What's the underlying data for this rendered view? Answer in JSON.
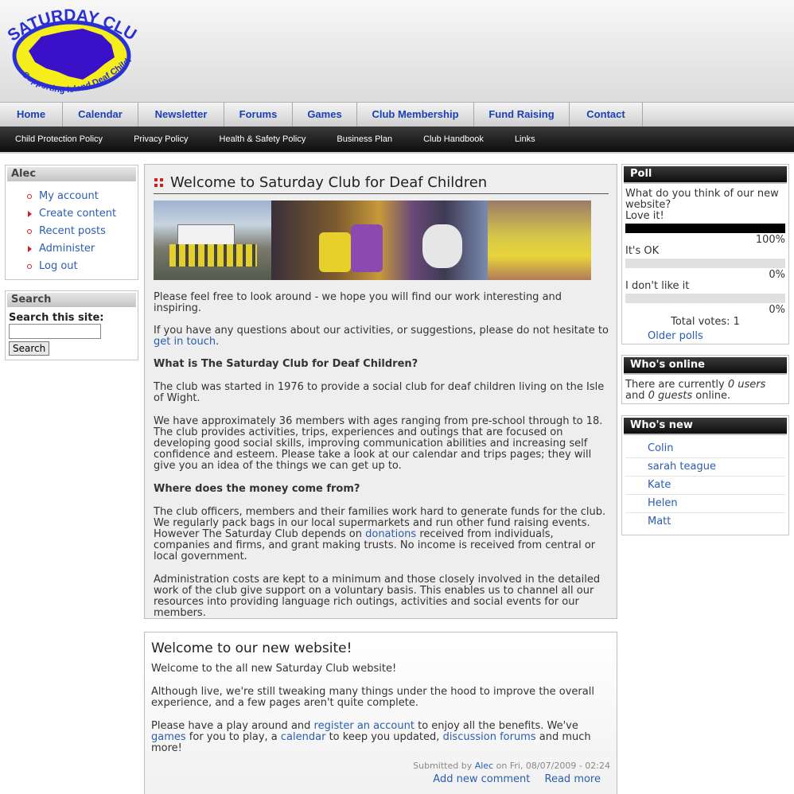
{
  "header": {
    "logo_title": "SATURDAY CLUB",
    "logo_tagline": "Supporting Island Deaf Children"
  },
  "primary_nav": [
    {
      "label": "Home"
    },
    {
      "label": "Calendar"
    },
    {
      "label": "Newsletter"
    },
    {
      "label": "Forums"
    },
    {
      "label": "Games"
    },
    {
      "label": "Club Membership"
    },
    {
      "label": "Fund Raising"
    },
    {
      "label": "Contact"
    }
  ],
  "secondary_nav": [
    {
      "label": "Child Protection Policy"
    },
    {
      "label": "Privacy Policy"
    },
    {
      "label": "Health & Safety Policy"
    },
    {
      "label": "Business Plan"
    },
    {
      "label": "Club Handbook"
    },
    {
      "label": "Links"
    }
  ],
  "user_block": {
    "title": "Alec",
    "items": [
      {
        "label": "My account"
      },
      {
        "label": "Create content"
      },
      {
        "label": "Recent posts"
      },
      {
        "label": "Administer"
      },
      {
        "label": "Log out"
      }
    ]
  },
  "search_block": {
    "title": "Search",
    "label": "Search this site:",
    "input_value": "",
    "button_label": "Search"
  },
  "main_node": {
    "title": "Welcome to Saturday Club for Deaf Children",
    "p1": "Please feel free to look around - we hope you will find our work interesting and inspiring.",
    "p2_text": "If you have any questions about our activities, or suggestions, please do not hesitate to",
    "p2_link": "get in touch",
    "p2_end": ".",
    "h1": "What is The Saturday Club for Deaf Children?",
    "p3": "The club was started in 1976 to provide a social club for deaf children living on the Isle of Wight.",
    "p4": "We have approximately 36 members with ages ranging from pre-school through to 18. The club provides activities, trips, experiences and outings that are focused on developing good social skills, improving communication abilities and increasing self confidence and esteem. Please take a look at our calendar and trips pages; they will give you an idea of the things we can get up to.",
    "h2": "Where does the money come from?",
    "p5_a": "The club officers, members and their families work hard to generate funds for the club. We regularly pack bags in our local supermarkets and run other fund raising events. However The Saturday Club depends on",
    "p5_link": "donations",
    "p5_b": "received from individuals, companies and firms, and grant making trusts. No income is received from central or local government.",
    "p6": "Administration costs are kept to a minimum and those closely involved in the detailed work of the club give support on a voluntary basis. This enables us to channel all our resources into providing language rich outings, activities and social events for our members."
  },
  "promo_node": {
    "title": "Welcome to our new website!",
    "p1": "Welcome to the all new Saturday Club website!",
    "p2": "Although live, we're still tweaking many things under the hood to improve the overall experience, and a few pages aren't quite complete.",
    "p3_a": "Please have a play around and",
    "p3_link1": "register an account",
    "p3_b": "to enjoy all the benefits. We've",
    "p3_link2": "games",
    "p3_c": "for you to play, a",
    "p3_link3": "calendar",
    "p3_d": "to keep you updated,",
    "p3_link4": "discussion forums",
    "p3_e": "and much more!",
    "submitted_prefix": "Submitted by",
    "submitted_user": "Alec",
    "submitted_date": "on Fri, 08/07/2009 - 02:24",
    "add_comment": "Add new comment",
    "read_more": "Read more"
  },
  "poll": {
    "title": "Poll",
    "question": "What do you think of our new website?",
    "choices": [
      {
        "label": "Love it!",
        "percent_text": "100%",
        "fraction": 1.0
      },
      {
        "label": "It's OK",
        "percent_text": "0%",
        "fraction": 0.0
      },
      {
        "label": "I don't like it",
        "percent_text": "0%",
        "fraction": 0.0
      }
    ],
    "total": "Total votes: 1",
    "older": "Older polls"
  },
  "whos_online": {
    "title": "Who's online",
    "text_a": "There are currently",
    "users": "0 users",
    "text_b": "and",
    "guests": "0 guests",
    "text_c": "online."
  },
  "whos_new": {
    "title": "Who's new",
    "users": [
      "Colin",
      "sarah teague",
      "Kate",
      "Helen",
      "Matt"
    ]
  },
  "colors": {
    "link": "#2a5db0",
    "nav_text": "#1a3fb8",
    "logo_blue": "#2b2fd6",
    "logo_yellow": "#f5ee1a",
    "bullet_red": "#cc2222"
  }
}
